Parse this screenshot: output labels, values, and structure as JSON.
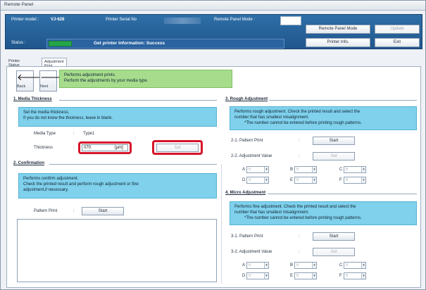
{
  "window": {
    "title": "Remote Panel"
  },
  "header": {
    "printer_model_label": "Printer model :",
    "printer_model_value": "VJ-628",
    "serial_label": "Printer Serial No",
    "mode_label": "Remote Panel Mode :",
    "status_label": "Status :",
    "status_text": "Get printer Information: Success",
    "buttons": {
      "remote_panel_mode": "Remote Panel Mode",
      "update": "Update",
      "printer_info": "Printer Info.",
      "exit": "Exit"
    }
  },
  "tabs": [
    {
      "label": "Printer Status"
    },
    {
      "label": "Adjustment Print"
    }
  ],
  "nav": {
    "back": "Back",
    "next": "Next"
  },
  "intro": {
    "lines": [
      "Performs adjustment prints.",
      "Perform the adjustments by your media type."
    ]
  },
  "media_thickness": {
    "title": "1.  Media Thickness",
    "info": [
      "Set the media thickness.",
      "If you do not know the thickness, leave in blank."
    ],
    "media_type_label": "Media Type",
    "media_type_colon": ":",
    "media_type_value": "Type1",
    "thickness_label": "Thickness",
    "thickness_colon": ":",
    "thickness_value": "070",
    "thickness_unit": "[μm]",
    "set_button": "Set"
  },
  "confirmation": {
    "title": "2.  Confirmation",
    "info": [
      "Performs confirm adjustment.",
      "Check the printed result and perform rough adjustment or fine",
      "adjustment,if necessary."
    ],
    "pattern_label": "Pattern Print",
    "pattern_colon": ":",
    "start_button": "Start"
  },
  "rough": {
    "title": "3.  Rough Adjustment",
    "info": [
      "Performs rough adjustment. Check the printed result and select the",
      "number that has smallest misalignment.",
      "*The number cannot be entered before printing rough patterns."
    ],
    "pattern_label": "2-1.  Pattern Print",
    "pattern_colon": ":",
    "start_button": "Start",
    "value_label": "2-2.  Adjustment Value",
    "value_colon": ":",
    "set_button": "Set",
    "spinners": [
      {
        "label": "A",
        "value": "0"
      },
      {
        "label": "B",
        "value": "0"
      },
      {
        "label": "C",
        "value": "0"
      },
      {
        "label": "D",
        "value": "0"
      },
      {
        "label": "E",
        "value": "0"
      },
      {
        "label": "F",
        "value": "0"
      }
    ]
  },
  "micro": {
    "title": "4.  Micro Adjustment",
    "info": [
      "Performs fine adjustment. Check the printed result and select the",
      "number that has smallest misalignment.",
      "*The number cannot be entered before printing rough patterns."
    ],
    "pattern_label": "3-1.  Pattern Print",
    "pattern_colon": ":",
    "start_button": "Start",
    "value_label": "3-2.  Adjustment Value",
    "value_colon": ":",
    "set_button": "Set",
    "spinners": [
      {
        "label": "A",
        "value": "0"
      },
      {
        "label": "B",
        "value": "0"
      },
      {
        "label": "C",
        "value": "0"
      },
      {
        "label": "D",
        "value": "0"
      },
      {
        "label": "E",
        "value": "0"
      },
      {
        "label": "F",
        "value": "0"
      }
    ]
  }
}
